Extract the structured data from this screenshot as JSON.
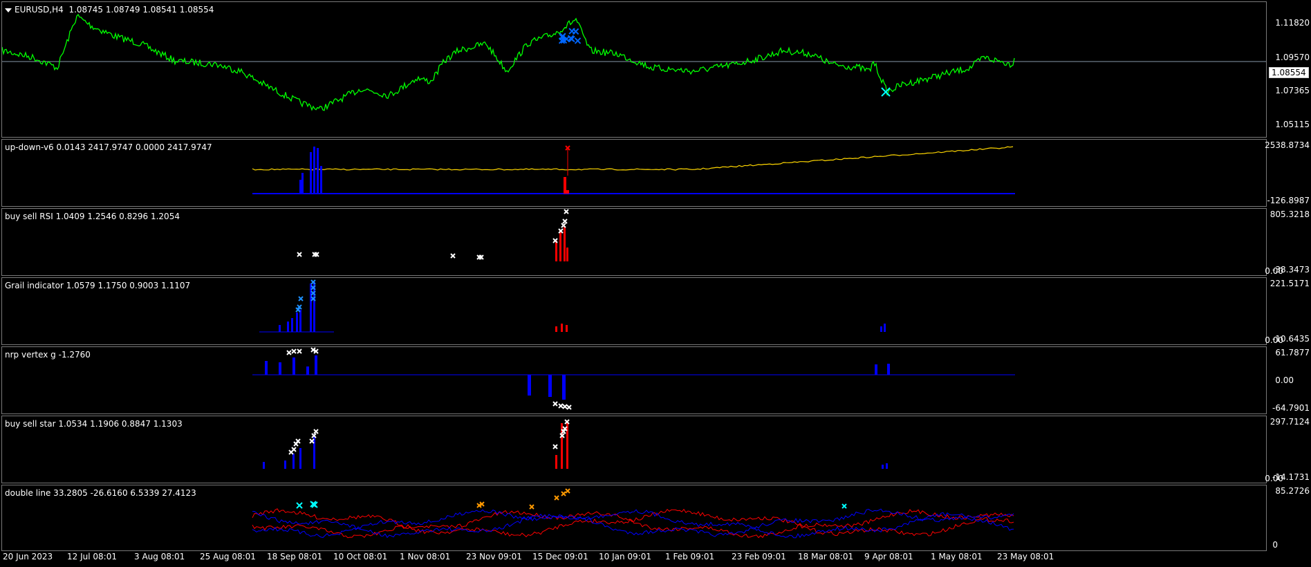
{
  "panes": [
    {
      "label": "EURUSD,H4  1.08745 1.08749 1.08541 1.08554",
      "axis": [
        "1.11820",
        "1.09570",
        "1.07365",
        "1.05115"
      ]
    },
    {
      "label": "up-down-v6 0.0143 2417.9747 0.0000 2417.9747",
      "axis": [
        "2538.8734",
        "-126.8987"
      ]
    },
    {
      "label": "buy sell RSI 1.0409 1.2546 0.8296 1.2054",
      "axis": [
        "805.3218",
        "0.00",
        "-38.3473"
      ]
    },
    {
      "label": "Grail indicator 1.0579 1.1750 0.9003 1.1107",
      "axis": [
        "221.5171",
        "0.00",
        "-10.6435"
      ]
    },
    {
      "label": "nrp vertex g -1.2760",
      "axis": [
        "61.7877",
        "0.00",
        "-64.7901"
      ]
    },
    {
      "label": "buy sell star 1.0534 1.1906 0.8847 1.1303",
      "axis": [
        "297.7124",
        "0.00",
        "-14.1731"
      ]
    },
    {
      "label": "double line 33.2805 -26.6160 6.5339 27.4123",
      "axis": [
        "85.2726",
        "0"
      ]
    }
  ],
  "price_marker": "1.08554",
  "dates": [
    "20 Jun 2023",
    "12 Jul 08:01",
    "3 Aug 08:01",
    "25 Aug 08:01",
    "18 Sep 08:01",
    "10 Oct 08:01",
    "1 Nov 08:01",
    "23 Nov 09:01",
    "15 Dec 09:01",
    "10 Jan 09:01",
    "1 Feb 09:01",
    "23 Feb 09:01",
    "18 Mar 08:01",
    "9 Apr 08:01",
    "1 May 08:01",
    "23 May 08:01"
  ],
  "colors": {
    "price": "#00ff00",
    "yellow": "#ffd700",
    "blue": "#0000ff",
    "red": "#ff0000",
    "cyan": "#00ffff",
    "orange": "#ff9900",
    "white": "#ffffff",
    "grail_blue": "#1e90ff"
  }
}
